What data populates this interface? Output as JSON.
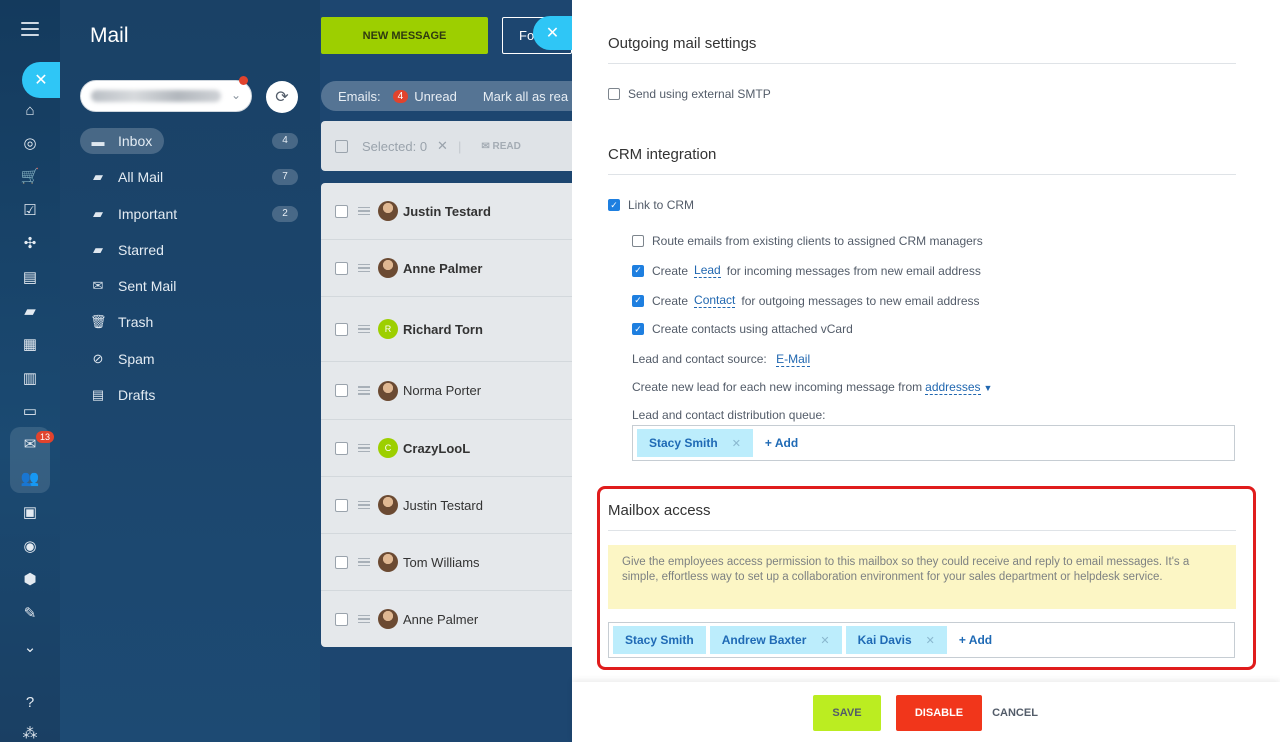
{
  "rail": {
    "menu_icon": "hamburger-icon",
    "close_icon": "close-icon",
    "mail_badge": "13",
    "items": [
      "home-icon",
      "target-icon",
      "cart-icon",
      "checkbox-icon",
      "network-icon",
      "feed-icon",
      "chat-icon",
      "calendar-icon",
      "document-icon",
      "drive-icon",
      "mail-icon",
      "team-icon",
      "contact-card-icon",
      "robot-icon",
      "box-icon",
      "signature-icon",
      "more-icon",
      "help-icon",
      "sitemap-icon"
    ]
  },
  "mail": {
    "title": "Mail",
    "refresh_icon": "refresh-icon",
    "folders": [
      {
        "label": "Inbox",
        "count": "4",
        "icon": "inbox-icon"
      },
      {
        "label": "All Mail",
        "count": "7",
        "icon": "folder-icon"
      },
      {
        "label": "Important",
        "count": "2",
        "icon": "folder-icon"
      },
      {
        "label": "Starred",
        "count": "",
        "icon": "folder-icon"
      },
      {
        "label": "Sent Mail",
        "count": "",
        "icon": "sent-icon"
      },
      {
        "label": "Trash",
        "count": "",
        "icon": "trash-icon"
      },
      {
        "label": "Spam",
        "count": "",
        "icon": "spam-icon"
      },
      {
        "label": "Drafts",
        "count": "",
        "icon": "draft-icon"
      }
    ]
  },
  "list": {
    "new_message": "NEW MESSAGE",
    "fo_button": "Fo",
    "emails_label": "Emails:",
    "unread_count": "4",
    "unread_label": "Unread",
    "mark_all": "Mark all as rea",
    "selected": "Selected: 0",
    "read": "READ",
    "rows": [
      {
        "name": "Justin Testard",
        "bold": true,
        "avatar": ""
      },
      {
        "name": "Anne Palmer",
        "bold": true,
        "avatar": ""
      },
      {
        "name": "Richard Torn",
        "bold": true,
        "avatar": "R"
      },
      {
        "name": "Norma Porter",
        "bold": false,
        "avatar": ""
      },
      {
        "name": "CrazyLooL",
        "bold": true,
        "avatar": "C"
      },
      {
        "name": "Justin Testard",
        "bold": false,
        "avatar": ""
      },
      {
        "name": "Tom Williams",
        "bold": false,
        "avatar": ""
      },
      {
        "name": "Anne Palmer",
        "bold": false,
        "avatar": ""
      }
    ]
  },
  "panel": {
    "outgoing": {
      "title": "Outgoing mail settings",
      "smtp_label": "Send using external SMTP",
      "smtp_checked": false
    },
    "crm": {
      "title": "CRM integration",
      "link_label": "Link to CRM",
      "route_label": "Route emails from existing clients to assigned CRM managers",
      "create_word": "Create",
      "lead_link": "Lead",
      "lead_suffix": "for incoming messages from new email address",
      "contact_link": "Contact",
      "contact_suffix": "for outgoing messages to new email address",
      "vcard_label": "Create contacts using attached vCard",
      "source_label": "Lead and contact source:",
      "source_value": "E-Mail",
      "new_lead_label": "Create new lead for each new incoming message from",
      "new_lead_value": "addresses",
      "queue_label": "Lead and contact distribution queue:",
      "queue_tags": [
        "Stacy Smith"
      ],
      "add_label": "+ Add"
    },
    "access": {
      "title": "Mailbox access",
      "notice": "Give the employees access permission to this mailbox so they could receive and reply to email messages. It's a simple, effortless way to set up a collaboration environment for your sales department or helpdesk service.",
      "tags": [
        "Stacy Smith",
        "Andrew Baxter",
        "Kai Davis"
      ],
      "add_label": "+ Add"
    }
  },
  "footer": {
    "save": "SAVE",
    "disable": "DISABLE",
    "cancel": "CANCEL"
  },
  "colors": {
    "accent_green": "#bbed21",
    "danger_red": "#f1361b",
    "link_blue": "#2067b0",
    "checkbox_blue": "#1e7fe0",
    "highlight_frame": "#e01c1c"
  }
}
